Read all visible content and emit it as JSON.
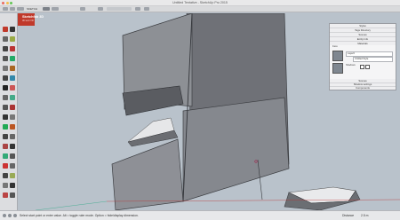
{
  "window": {
    "title": "Untitled Tentative - SketchUp Pro 2015"
  },
  "toolbar": {
    "label": "SKETCH"
  },
  "logo": {
    "name": "Sketchfab 3D",
    "tagline": "3D and VR"
  },
  "panel": {
    "rows": [
      "Styles",
      "Tags Directory",
      "Scenes",
      "Entity Info",
      "Materials"
    ],
    "section": "Face",
    "layer_value": "Layer0",
    "area_value": "Untitled Style",
    "shadows_label": "Shadows",
    "footer_rows": [
      "Scenes",
      "Shadow settings",
      "Components"
    ]
  },
  "status": {
    "message": "Select start point or enter value. Alt = toggle ruler mode. Option = hide/display dimension.",
    "distance_label": "Distance",
    "distance_value": "2.5 m"
  },
  "colors": {
    "viewport_sky": "#b9c2cb",
    "model_face": "#8e9096",
    "model_dark": "#55575c"
  }
}
